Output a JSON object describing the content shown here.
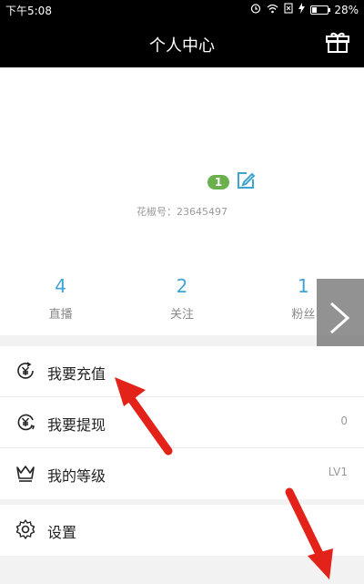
{
  "status_bar": {
    "time": "下午5:08",
    "battery": "28%",
    "battery_level": 0.28
  },
  "header": {
    "title": "个人中心"
  },
  "profile": {
    "level_badge": "1",
    "user_id": "花椒号：23645497"
  },
  "stats": [
    {
      "value": "4",
      "label": "直播"
    },
    {
      "value": "2",
      "label": "关注"
    },
    {
      "value": "1",
      "label": "粉丝"
    }
  ],
  "menu": {
    "recharge": {
      "label": "我要充值"
    },
    "withdraw": {
      "label": "我要提现",
      "value": "0"
    },
    "level": {
      "label": "我的等级",
      "value": "LV1"
    },
    "settings": {
      "label": "设置"
    }
  },
  "colors": {
    "header_bg": "#000000",
    "stat_number": "#3ea4d4",
    "badge_green": "#6ab04c",
    "edit_icon": "#3ea4d4",
    "annotation_arrow": "#e32219"
  }
}
